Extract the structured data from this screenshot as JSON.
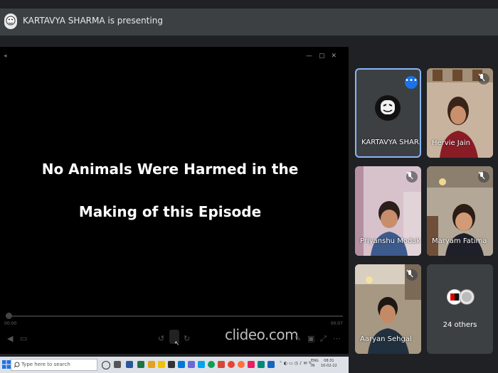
{
  "banner": {
    "presenting_text": "KARTAVYA SHARMA is presenting"
  },
  "presentation": {
    "slide_line1": "No Animals Were Harmed in the",
    "slide_line2": "Making of this Episode",
    "time_left": "00:00",
    "time_right": "00:07",
    "watermark": "clideo.com"
  },
  "participants": [
    {
      "name": "KARTAVYA SHAR..."
    },
    {
      "name": "Hervie Jain"
    },
    {
      "name": "Priyanshu Modak"
    },
    {
      "name": "Maryam Fatima"
    },
    {
      "name": "Aaryan Sehgal"
    }
  ],
  "others": {
    "label": "24 others"
  },
  "taskbar": {
    "search_placeholder": "Type here to search",
    "lang_top": "ENG",
    "lang_bottom": "IN",
    "time": "08:31",
    "date": "10-02-22"
  },
  "colors": {
    "accent": "#1a73e8",
    "tile_bg": "#3c4043",
    "active_border": "#8ab4f8"
  }
}
